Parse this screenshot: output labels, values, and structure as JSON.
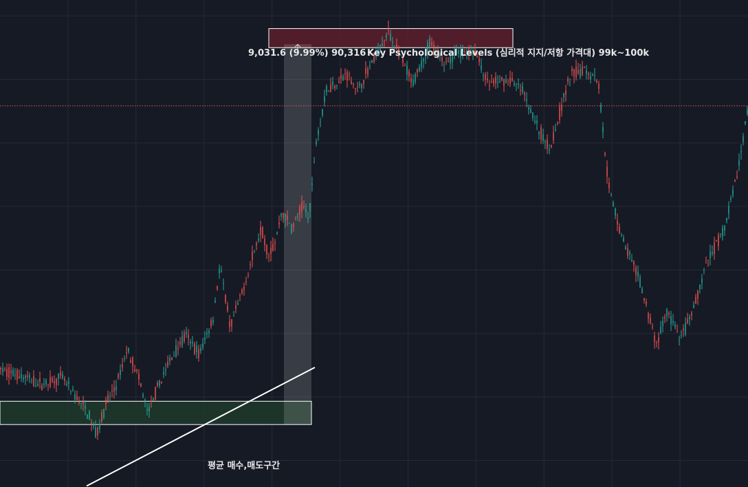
{
  "theme": {
    "background": "#161a25",
    "grid_color": "#242a36",
    "up_color": "#26a69a",
    "down_color": "#ef5350",
    "text_color": "#e8e8e8"
  },
  "annotations": {
    "measure_label": "9,031.6 (9.99%) 90,316",
    "resistance_label": "Key Psychological Levels (심리적 지지/저항 가격대) 99k~100k",
    "support_label": "평균 매수,매도구간"
  },
  "chart_data": {
    "type": "candlestick",
    "title": "",
    "xlabel": "",
    "ylabel": "",
    "ylim": [
      57500,
      103500
    ],
    "grid": true,
    "y_grid_levels": [
      60000,
      66000,
      72000,
      78000,
      84000,
      90000,
      96000,
      102000
    ],
    "x_grid_count": 10,
    "horizontal_price_line": 93500,
    "zones": [
      {
        "name": "resistance",
        "from": 99000,
        "to": 100800,
        "color": "#5c1f2c"
      },
      {
        "name": "support",
        "from": 63400,
        "to": 65600,
        "color": "#1f3a2c"
      }
    ],
    "measure": {
      "change": "9,031.6",
      "percent": "9.99%",
      "target": 90316
    },
    "trendline": {
      "from": [
        0.126,
        57600
      ],
      "to": [
        0.458,
        68800
      ]
    },
    "anchors": [
      [
        0,
        68600
      ],
      [
        0.03,
        68000
      ],
      [
        0.06,
        67200
      ],
      [
        0.09,
        67800
      ],
      [
        0.11,
        66000
      ],
      [
        0.125,
        64800
      ],
      [
        0.14,
        62500
      ],
      [
        0.155,
        65500
      ],
      [
        0.17,
        67200
      ],
      [
        0.185,
        70500
      ],
      [
        0.2,
        68200
      ],
      [
        0.215,
        64500
      ],
      [
        0.23,
        67000
      ],
      [
        0.25,
        69800
      ],
      [
        0.27,
        71800
      ],
      [
        0.29,
        70000
      ],
      [
        0.31,
        73500
      ],
      [
        0.32,
        78500
      ],
      [
        0.335,
        72500
      ],
      [
        0.355,
        76500
      ],
      [
        0.38,
        82000
      ],
      [
        0.39,
        79500
      ],
      [
        0.4,
        80500
      ],
      [
        0.41,
        83500
      ],
      [
        0.425,
        82000
      ],
      [
        0.44,
        84000
      ],
      [
        0.45,
        83000
      ],
      [
        0.46,
        90300
      ],
      [
        0.475,
        95000
      ],
      [
        0.505,
        96500
      ],
      [
        0.52,
        95000
      ],
      [
        0.54,
        97500
      ],
      [
        0.565,
        100500
      ],
      [
        0.58,
        98500
      ],
      [
        0.6,
        95500
      ],
      [
        0.625,
        99500
      ],
      [
        0.645,
        97500
      ],
      [
        0.665,
        98500
      ],
      [
        0.69,
        98800
      ],
      [
        0.71,
        95500
      ],
      [
        0.74,
        96000
      ],
      [
        0.76,
        95000
      ],
      [
        0.785,
        91000
      ],
      [
        0.8,
        89500
      ],
      [
        0.815,
        93000
      ],
      [
        0.83,
        96500
      ],
      [
        0.85,
        97000
      ],
      [
        0.87,
        96000
      ],
      [
        0.885,
        86000
      ],
      [
        0.905,
        81000
      ],
      [
        0.93,
        77000
      ],
      [
        0.955,
        71000
      ],
      [
        0.97,
        74000
      ],
      [
        0.99,
        71500
      ],
      [
        1.005,
        73500
      ],
      [
        1.03,
        79000
      ],
      [
        1.055,
        82000
      ],
      [
        1.075,
        88000
      ],
      [
        1.088,
        93500
      ]
    ]
  }
}
